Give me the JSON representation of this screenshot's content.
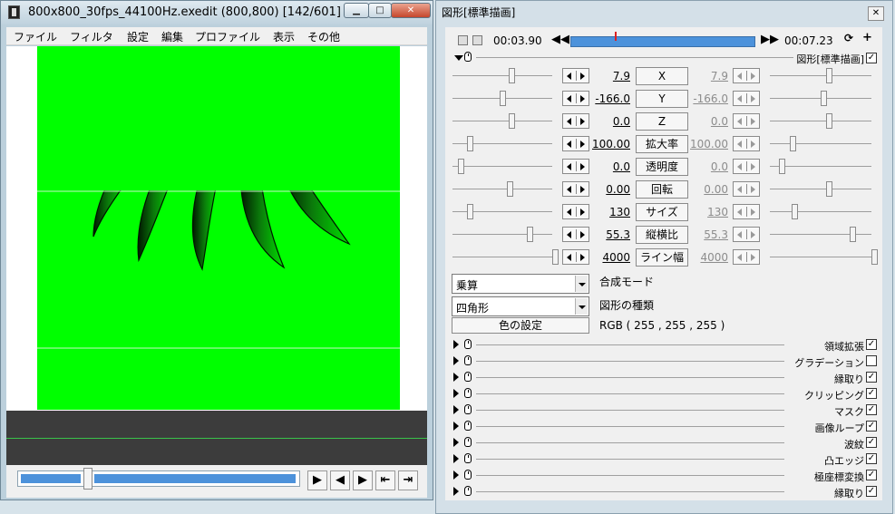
{
  "main_window": {
    "title": "800x800_30fps_44100Hz.exedit (800,800)  [142/601]  ...",
    "caption_buttons": [
      "minimize",
      "maximize",
      "close"
    ],
    "menu": [
      "ファイル",
      "フィルタ",
      "設定",
      "編集",
      "プロファイル",
      "表示",
      "その他"
    ],
    "canvas_color": "#00ff00",
    "controls": [
      "play-icon",
      "prev-frame-icon",
      "next-frame-icon",
      "first-frame-icon",
      "last-frame-icon"
    ]
  },
  "dialog": {
    "title": "図形[標準描画]",
    "time_start": "00:03.90",
    "time_end": "00:07.23",
    "object_label": "図形[標準描画]",
    "params": [
      {
        "name": "X",
        "left": "7.9",
        "right": "7.9"
      },
      {
        "name": "Y",
        "left": "-166.0",
        "right": "-166.0"
      },
      {
        "name": "Z",
        "left": "0.0",
        "right": "0.0"
      },
      {
        "name": "拡大率",
        "left": "100.00",
        "right": "100.00"
      },
      {
        "name": "透明度",
        "left": "0.0",
        "right": "0.0"
      },
      {
        "name": "回転",
        "left": "0.00",
        "right": "0.00"
      },
      {
        "name": "サイズ",
        "left": "130",
        "right": "130"
      },
      {
        "name": "縦横比",
        "left": "55.3",
        "right": "55.3"
      },
      {
        "name": "ライン幅",
        "left": "4000",
        "right": "4000"
      }
    ],
    "blend_mode": {
      "value": "乗算",
      "label": "合成モード"
    },
    "shape_type": {
      "value": "四角形",
      "label": "図形の種類"
    },
    "color_button": "色の設定",
    "rgb_text": "RGB ( 255 , 255 , 255 )",
    "filters": [
      {
        "label": "領域拡張",
        "checked": true
      },
      {
        "label": "グラデーション",
        "checked": false
      },
      {
        "label": "縁取り",
        "checked": true
      },
      {
        "label": "クリッピング",
        "checked": true
      },
      {
        "label": "マスク",
        "checked": true
      },
      {
        "label": "画像ループ",
        "checked": true
      },
      {
        "label": "波紋",
        "checked": true
      },
      {
        "label": "凸エッジ",
        "checked": true
      },
      {
        "label": "極座標変換",
        "checked": true
      },
      {
        "label": "縁取り",
        "checked": true
      }
    ],
    "check_mark": "✓"
  }
}
